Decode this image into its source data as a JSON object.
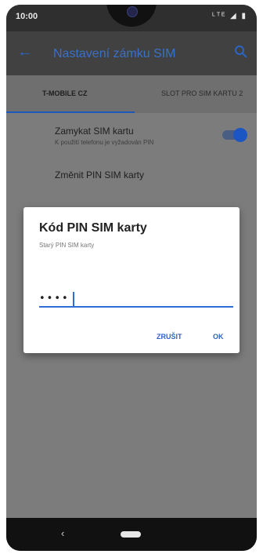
{
  "status_bar": {
    "time": "10:00",
    "icons": [
      "lte-icon",
      "signal-icon",
      "battery-icon"
    ],
    "icon_text": "ᴸᵀᴱ ◢ ▮"
  },
  "app_bar": {
    "title": "Nastavení zámku SIM",
    "back_icon": "arrow-back-icon",
    "search_icon": "search-icon"
  },
  "tabs": [
    {
      "label": "T-MOBILE CZ",
      "selected": true
    },
    {
      "label": "SLOT PRO SIM KARTU 2",
      "selected": false
    }
  ],
  "settings": {
    "lock_sim": {
      "title": "Zamykat SIM kartu",
      "subtitle": "K použití telefonu je vyžadován PIN",
      "enabled": true
    },
    "change_pin": {
      "title": "Změnit PIN SIM karty"
    }
  },
  "dialog": {
    "title": "Kód PIN SIM karty",
    "subtitle": "Starý PIN SIM karty",
    "pin_value": "••••",
    "cancel_label": "ZRUŠIT",
    "ok_label": "OK"
  },
  "nav_bar": {
    "back_glyph": "‹"
  },
  "colors": {
    "accent": "#2d64c7",
    "dim_background": "#7c7c7c",
    "toggle_thumb": "#1c56c2"
  }
}
